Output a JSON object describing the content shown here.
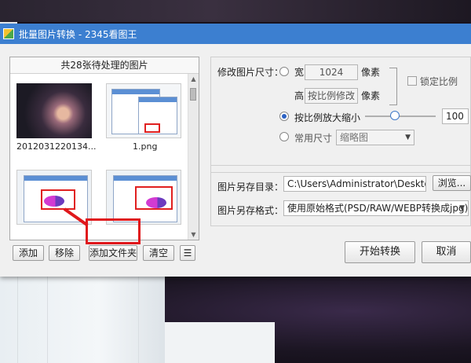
{
  "window": {
    "title": "批量图片转换 - 2345看图王"
  },
  "left_panel": {
    "header": "共28张待处理的图片",
    "thumbnails": [
      {
        "label": "2012031220134..."
      },
      {
        "label": "1.png"
      },
      {
        "label": ""
      },
      {
        "label": ""
      }
    ],
    "buttons": {
      "add": "添加",
      "remove": "移除",
      "add_folder": "添加文件夹",
      "clear": "清空"
    }
  },
  "resize": {
    "label": "修改图片尺寸：",
    "width_label": "宽",
    "width_value": "1024",
    "width_unit": "像素",
    "height_label": "高",
    "height_value": "按比例修改",
    "height_unit": "像素",
    "lock_ratio_label": "锁定比例",
    "scale_label": "按比例放大缩小",
    "scale_value": "100",
    "common_size_label": "常用尺寸",
    "common_size_value": "缩略图",
    "selected_mode": "scale"
  },
  "output": {
    "dir_label": "图片另存目录：",
    "dir_value": "C:\\Users\\Administrator\\Desktop\\",
    "browse_button": "浏览...",
    "format_label": "图片另存格式：",
    "format_value": "使用原始格式(PSD/RAW/WEBP转换成jpg)"
  },
  "actions": {
    "start": "开始转换",
    "cancel": "取消"
  },
  "colors": {
    "titlebar": "#3c7fd0",
    "highlight": "#e0181c"
  }
}
